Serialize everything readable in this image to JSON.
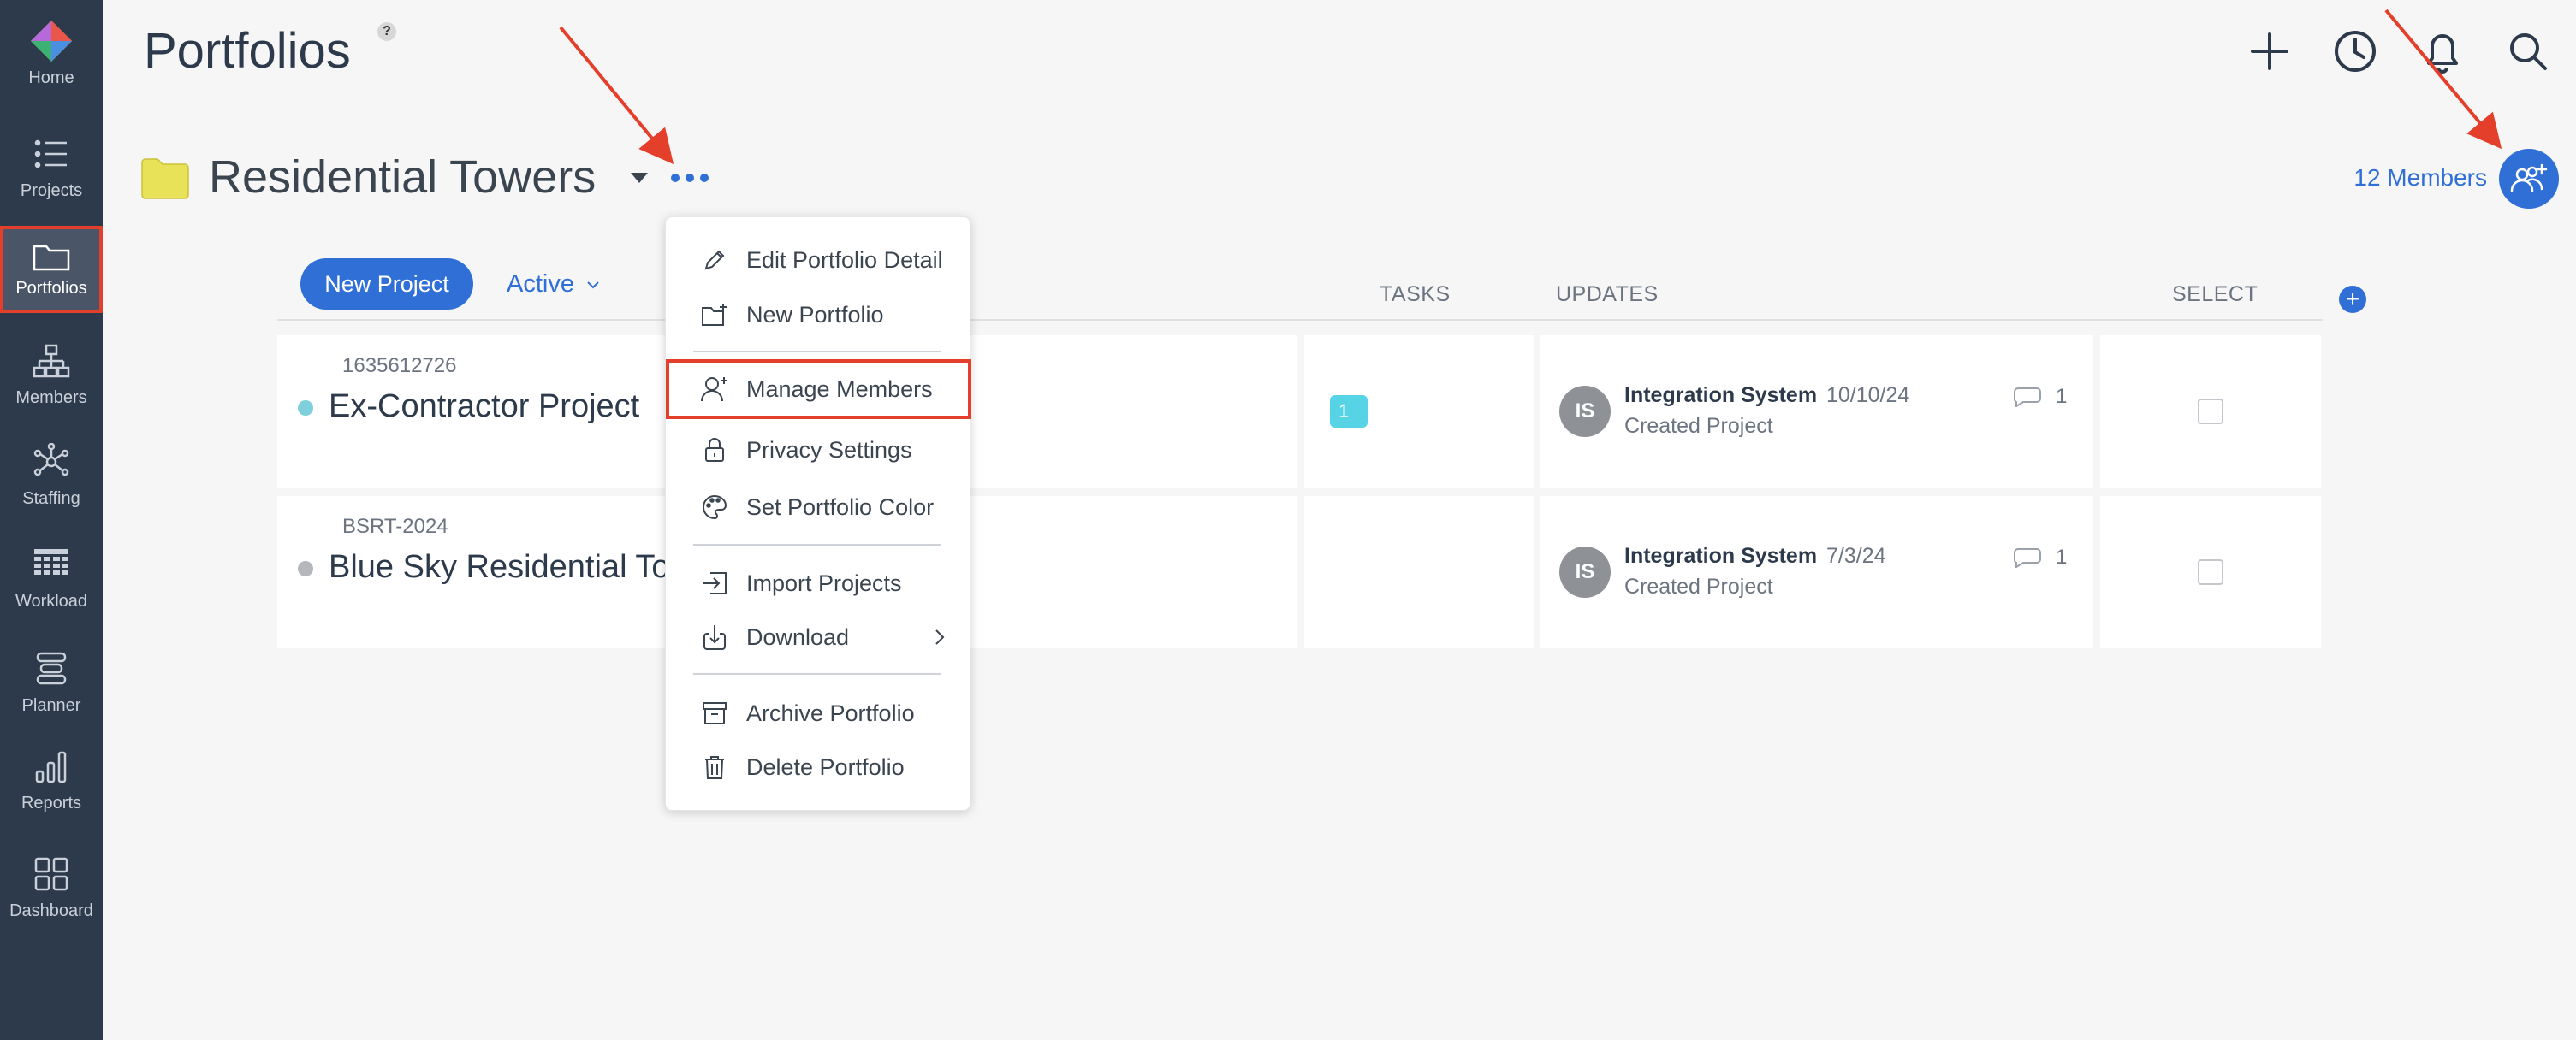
{
  "sidebar": {
    "items": [
      {
        "label": "Home",
        "icon": "home-logo-icon"
      },
      {
        "label": "Projects",
        "icon": "list-icon"
      },
      {
        "label": "Portfolios",
        "icon": "folder-icon",
        "active": true
      },
      {
        "label": "Members",
        "icon": "org-chart-icon"
      },
      {
        "label": "Staffing",
        "icon": "network-icon"
      },
      {
        "label": "Workload",
        "icon": "grid-icon"
      },
      {
        "label": "Planner",
        "icon": "planner-icon"
      },
      {
        "label": "Reports",
        "icon": "bar-chart-icon"
      },
      {
        "label": "Dashboard",
        "icon": "dashboard-icon"
      }
    ]
  },
  "header": {
    "title": "Portfolios",
    "help": "?",
    "icons": [
      "plus-icon",
      "clock-icon",
      "bell-icon",
      "search-icon"
    ]
  },
  "portfolio": {
    "name": "Residential Towers",
    "members_label": "12 Members",
    "folder_color": "#e8e259"
  },
  "controls": {
    "new_project": "New Project",
    "status_filter": "Active"
  },
  "columns": {
    "tasks": "TASKS",
    "updates": "UPDATES",
    "select": "SELECT",
    "add": "+"
  },
  "projects": [
    {
      "id": "1635612726",
      "name": "Ex-Contractor Project",
      "dot_color": "#7fd0dc",
      "tasks": "1",
      "update": {
        "initials": "IS",
        "author": "Integration System",
        "date": "10/10/24",
        "text": "Created Project",
        "comments": "1"
      }
    },
    {
      "id": "BSRT-2024",
      "name": "Blue Sky Residential To",
      "dot_color": "#b4b7bb",
      "tasks": "",
      "update": {
        "initials": "IS",
        "author": "Integration System",
        "date": "7/3/24",
        "text": "Created Project",
        "comments": "1"
      }
    }
  ],
  "menu": {
    "items": [
      {
        "label": "Edit Portfolio Detail",
        "icon": "pencil-icon"
      },
      {
        "label": "New Portfolio",
        "icon": "new-folder-icon"
      },
      {
        "label": "Manage Members",
        "icon": "add-person-icon",
        "highlight": true
      },
      {
        "label": "Privacy Settings",
        "icon": "lock-icon"
      },
      {
        "label": "Set Portfolio Color",
        "icon": "palette-icon"
      },
      {
        "label": "Import Projects",
        "icon": "import-icon"
      },
      {
        "label": "Download",
        "icon": "download-icon",
        "submenu": true
      },
      {
        "label": "Archive Portfolio",
        "icon": "archive-icon"
      },
      {
        "label": "Delete Portfolio",
        "icon": "trash-icon"
      }
    ]
  },
  "colors": {
    "sidebar": "#2d3a4b",
    "accent": "#2f6fd6",
    "annotation": "#e43f2a"
  }
}
